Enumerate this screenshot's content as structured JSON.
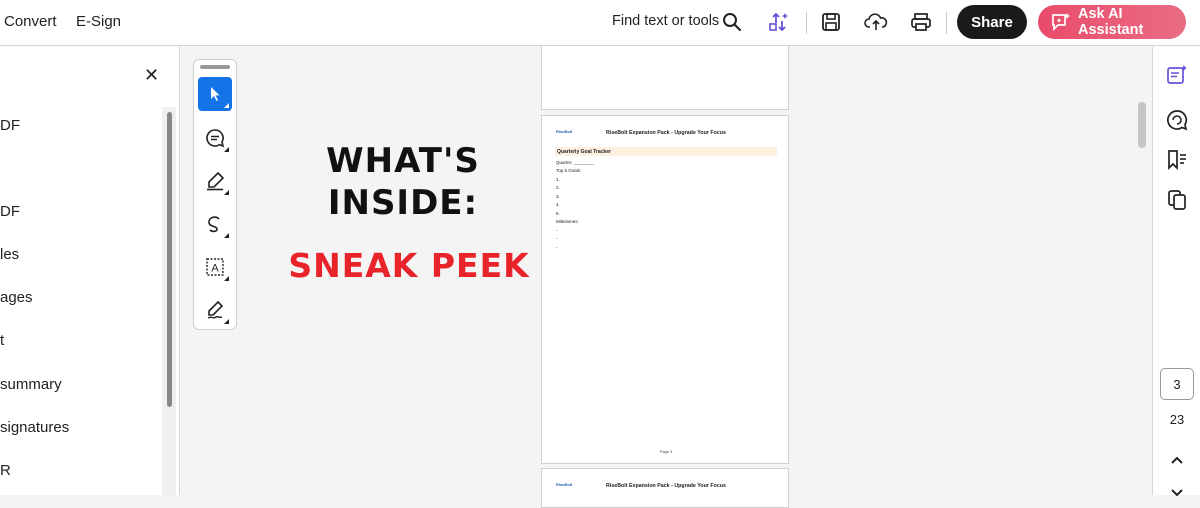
{
  "menu": {
    "convert": "Convert",
    "esign": "E-Sign"
  },
  "header": {
    "find_label": "Find text or tools",
    "share_label": "Share",
    "ai_label": "Ask AI Assistant"
  },
  "left_panel": {
    "items": [
      "DF",
      "DF",
      "les",
      "ages",
      "t",
      " summary",
      "signatures",
      "R"
    ]
  },
  "document": {
    "headline_line1": "WHAT'S",
    "headline_line2": "INSIDE:",
    "subheadline": "SNEAK PEEK",
    "page_header": "RiseBolt Expansion Pack - Upgrade Your Focus",
    "logo_text": "RiseBolt",
    "band_title": "Quarterly Goal Tracker",
    "lines": [
      "Quarter: ________",
      "Top 5 Goals:",
      "1.",
      "2.",
      "3.",
      "4.",
      "5.",
      "Milestones:",
      "-",
      "-",
      "-"
    ],
    "page_footer": "Page 3"
  },
  "pagination": {
    "current": "3",
    "total": "23"
  },
  "colors": {
    "accent": "#1473e6",
    "ai_button": "#e94b6a",
    "sneak_peek": "#e8232a",
    "icon_purple": "#6b4fd8"
  }
}
